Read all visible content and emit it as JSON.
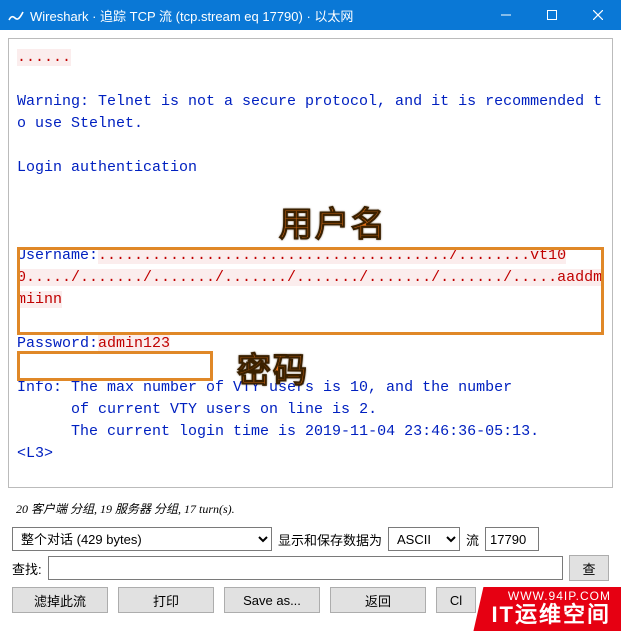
{
  "window": {
    "title": "Wireshark · 追踪 TCP 流 (tcp.stream eq 17790) · 以太网"
  },
  "stream": {
    "dots1": "......",
    "warning": "Warning: Telnet is not a secure protocol, and it is recommended to use Stelnet.",
    "loginauth": "Login authentication",
    "username_label": "Username:",
    "username_red_dots": "......................................./........",
    "username_red_tail": "vt100",
    "username_dots2": "...../......./......./......./......./......./......./.....",
    "username_typed": "aaddmmiinn",
    "password_label": "Password:",
    "password_value": "admin123",
    "info_line1": "Info: The max number of VTY users is 10, and the number",
    "info_line2": "      of current VTY users on line is 2.",
    "info_line3": "      The current login time is 2019-11-04 23:46:36-05:13.",
    "prompt": "<L3>"
  },
  "annotations": {
    "username_cn": "用户名",
    "password_cn": "密码"
  },
  "stats": {
    "full": "20 客户端 分组, 19 服务器 分组, 17 turn(s)."
  },
  "controls": {
    "conversation_select": "整个对话 (429 bytes)",
    "display_save_label": "显示和保存数据为",
    "encoding_select": "ASCII",
    "stream_label": "流",
    "stream_value": "17790",
    "find_label": "查找:",
    "find_button": "查"
  },
  "buttons": {
    "filter_out": "滤掉此流",
    "print": "打印",
    "save_as": "Save as...",
    "back": "返回",
    "close": "Cl"
  },
  "watermark": {
    "line1": "WWW.94IP.COM",
    "line2": "IT运维空间"
  }
}
